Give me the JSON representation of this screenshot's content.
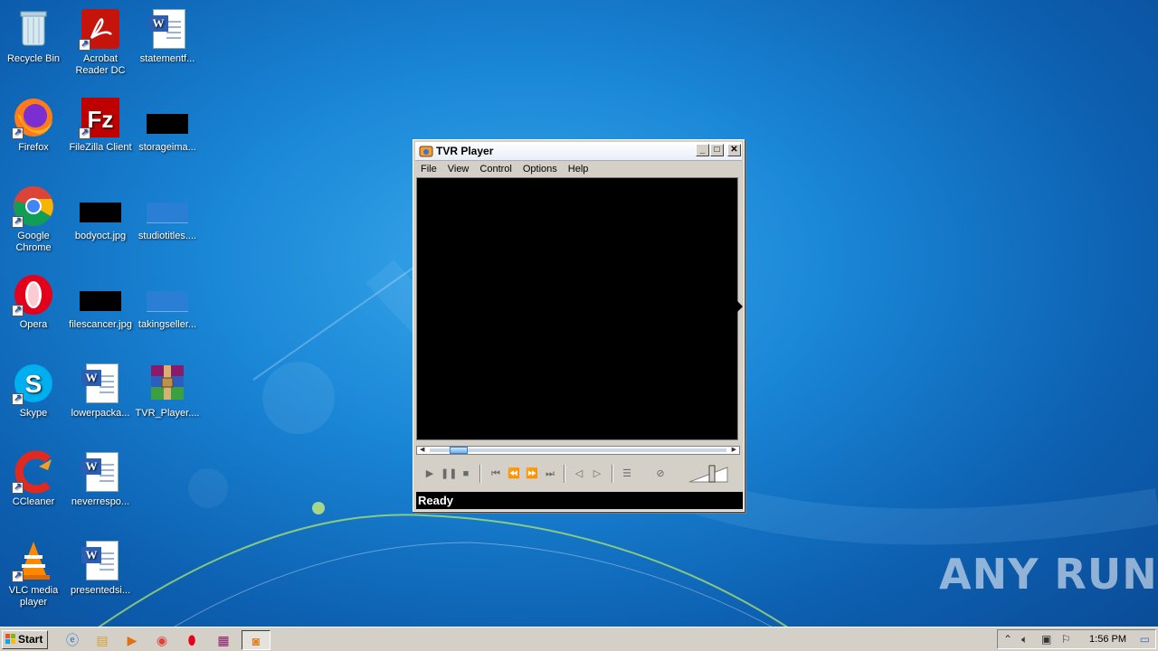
{
  "desktop": {
    "icons": [
      {
        "label": "Recycle Bin",
        "icon": "recycle-bin-icon"
      },
      {
        "label": "Acrobat Reader DC",
        "icon": "acrobat-icon"
      },
      {
        "label": "statementf...",
        "icon": "word-doc-icon"
      },
      {
        "label": "Firefox",
        "icon": "firefox-icon"
      },
      {
        "label": "FileZilla Client",
        "icon": "filezilla-icon"
      },
      {
        "label": "storageima...",
        "icon": "image-file-icon"
      },
      {
        "label": "Google Chrome",
        "icon": "chrome-icon"
      },
      {
        "label": "bodyoct.jpg",
        "icon": "image-file-icon"
      },
      {
        "label": "studiotitles....",
        "icon": "image-file-icon"
      },
      {
        "label": "Opera",
        "icon": "opera-icon"
      },
      {
        "label": "filescancer.jpg",
        "icon": "image-file-icon"
      },
      {
        "label": "takingseller...",
        "icon": "image-file-icon"
      },
      {
        "label": "Skype",
        "icon": "skype-icon"
      },
      {
        "label": "lowerpacka...",
        "icon": "word-doc-icon"
      },
      {
        "label": "TVR_Player....",
        "icon": "winrar-icon"
      },
      {
        "label": "CCleaner",
        "icon": "ccleaner-icon"
      },
      {
        "label": "neverrespo...",
        "icon": "word-doc-icon"
      },
      {
        "label": "VLC media player",
        "icon": "vlc-icon"
      },
      {
        "label": "presentedsi...",
        "icon": "word-doc-icon"
      }
    ]
  },
  "window": {
    "title": "TVR Player",
    "minimize": "_",
    "maximize": "□",
    "close": "✕",
    "menu": [
      "File",
      "View",
      "Control",
      "Options",
      "Help"
    ],
    "status": "Ready",
    "seek_position": 0.07
  },
  "taskbar": {
    "start_label": "Start",
    "clock": "1:56 PM"
  },
  "watermark": "ANY RUN",
  "colors": {
    "desktop_bg": "#1a86d6",
    "taskbar": "#d4d0c8",
    "video_bg": "#000000"
  }
}
